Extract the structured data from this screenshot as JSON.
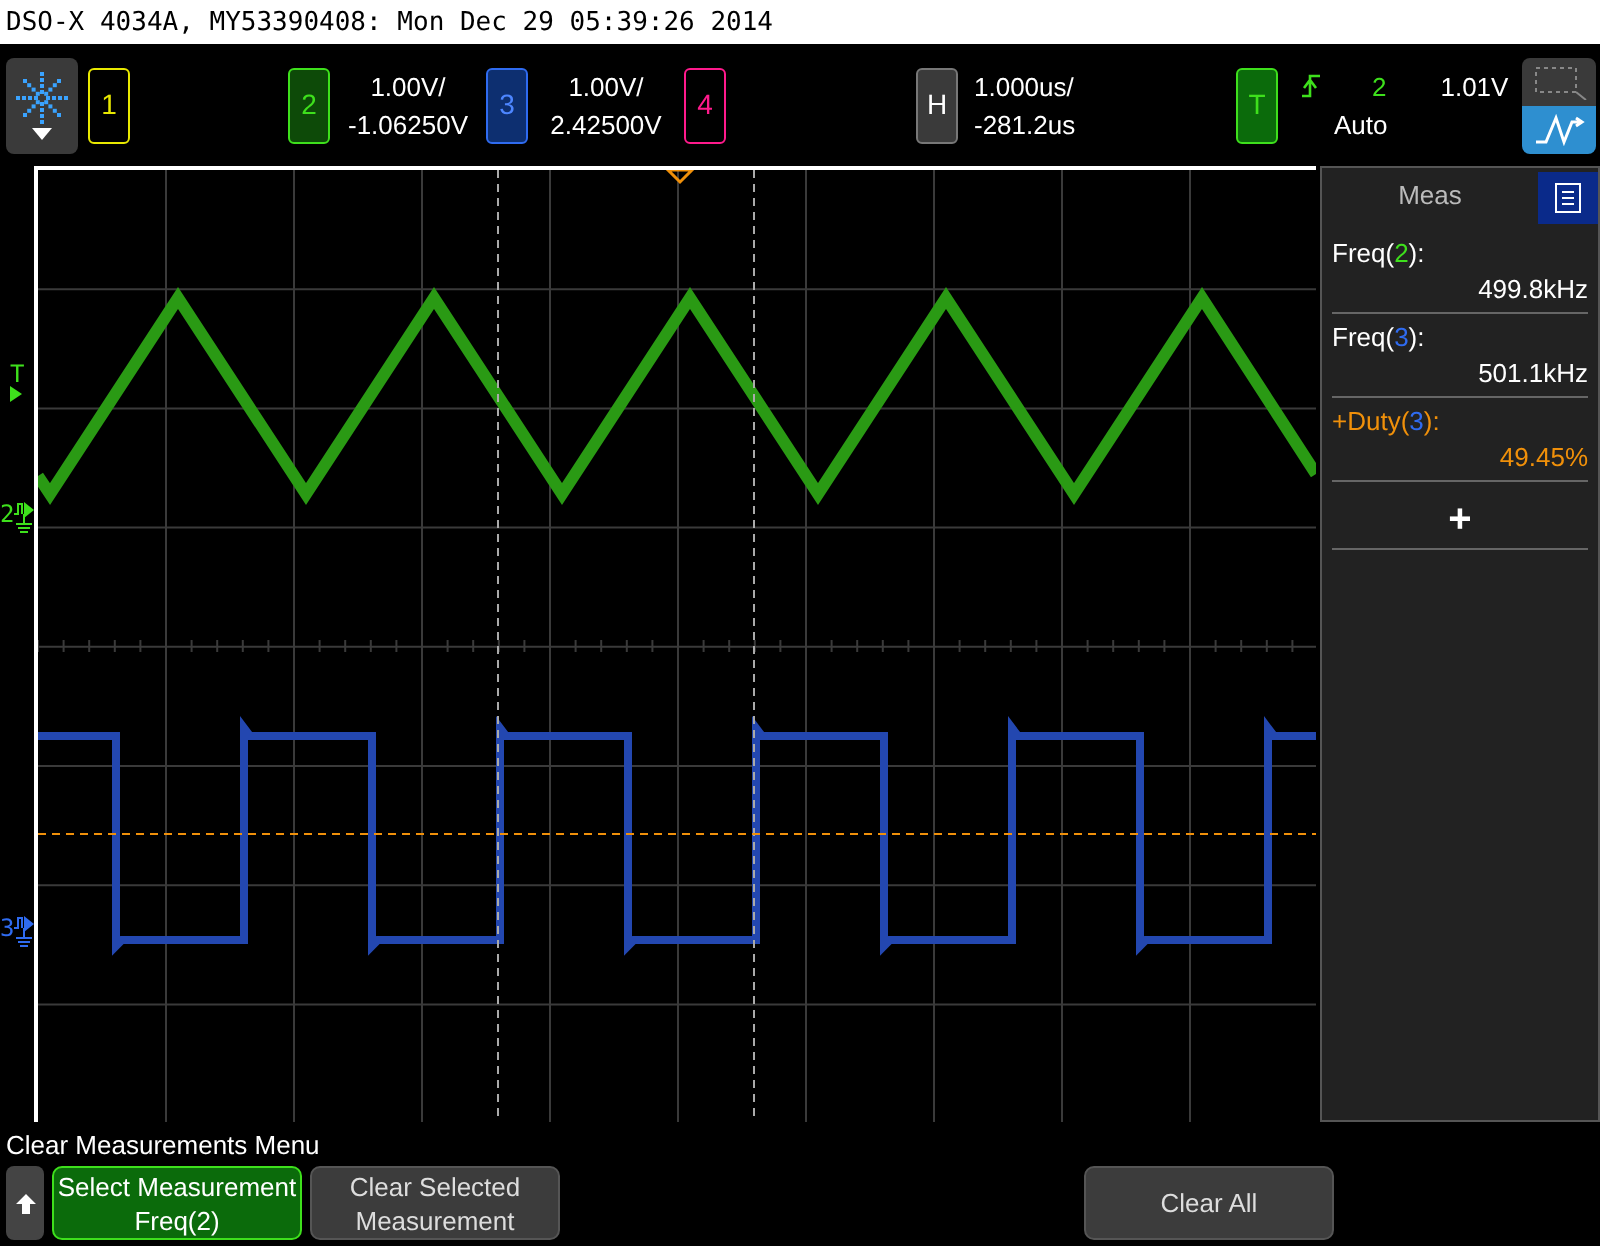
{
  "window": {
    "title": "DSO-X 4034A, MY53390408: Mon Dec 29 05:39:26 2014"
  },
  "channels": [
    {
      "number": "1",
      "enabled": false,
      "color": "#e8e800"
    },
    {
      "number": "2",
      "enabled": true,
      "color": "#3ee01c",
      "scale": "1.00V/",
      "offset": "-1.06250V"
    },
    {
      "number": "3",
      "enabled": true,
      "color": "#2f6bf0",
      "scale": "1.00V/",
      "offset": "2.42500V"
    },
    {
      "number": "4",
      "enabled": false,
      "color": "#ff1a8c"
    }
  ],
  "horizontal": {
    "label": "H",
    "scale": "1.000us/",
    "position": "-281.2us"
  },
  "trigger": {
    "label": "T",
    "source": "2",
    "level": "1.01V",
    "mode": "Auto"
  },
  "markers": [
    {
      "label": "T",
      "kind": "trigger",
      "color": "#3ee01c"
    },
    {
      "label": "2",
      "kind": "ground",
      "color": "#3ee01c"
    },
    {
      "label": "3",
      "kind": "ground",
      "color": "#2f6bf0"
    }
  ],
  "measurements_panel": {
    "tab": "Meas",
    "measurements": [
      {
        "prefix": "Freq(",
        "source": "2",
        "suffix": "):",
        "color": "#3ee01c",
        "value": "499.8kHz",
        "highlighted": false
      },
      {
        "prefix": "Freq(",
        "source": "3",
        "suffix": "):",
        "color": "#2f6bf0",
        "value": "501.1kHz",
        "highlighted": false
      },
      {
        "prefix": "+Duty(",
        "source": "3",
        "suffix": "):",
        "color": "#2f6bf0",
        "value": "49.45%",
        "highlighted": true
      }
    ],
    "add_label": "+"
  },
  "menu": {
    "title": "Clear Measurements Menu",
    "softkeys": [
      {
        "kind": "key",
        "lines": [
          "Select Measurement",
          "Freq(2)"
        ],
        "selected": true
      },
      {
        "kind": "key",
        "lines": [
          "Clear Selected",
          "Measurement"
        ],
        "selected": false
      },
      {
        "kind": "blank"
      },
      {
        "kind": "blank"
      },
      {
        "kind": "key",
        "lines": [
          "Clear All"
        ],
        "selected": false
      }
    ]
  }
}
